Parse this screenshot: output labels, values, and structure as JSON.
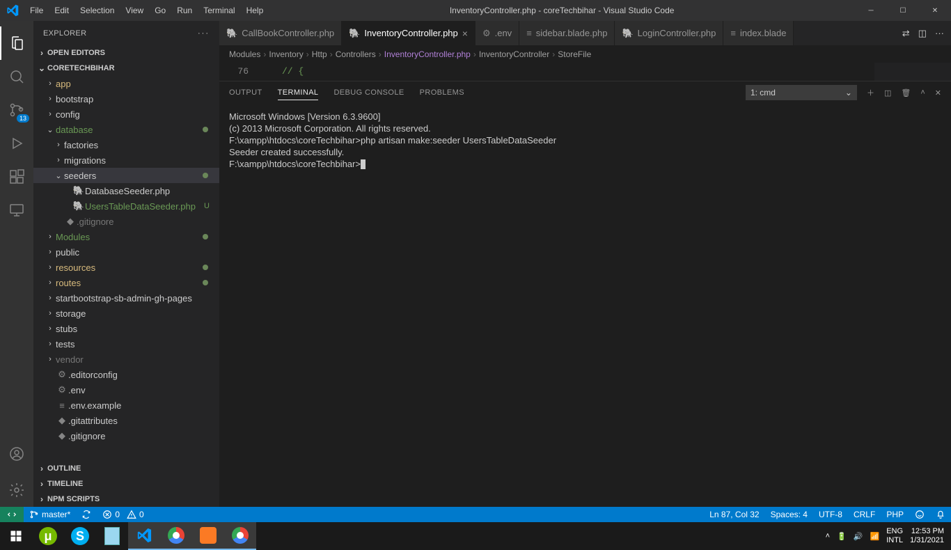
{
  "titlebar": {
    "menus": [
      "File",
      "Edit",
      "Selection",
      "View",
      "Go",
      "Run",
      "Terminal",
      "Help"
    ],
    "title": "InventoryController.php - coreTechbihar - Visual Studio Code"
  },
  "activitybar": {
    "badge": "13"
  },
  "sidebar": {
    "title": "EXPLORER",
    "sections": {
      "open_editors": "OPEN EDITORS",
      "project": "CORETECHBIHAR",
      "outline": "OUTLINE",
      "timeline": "TIMELINE",
      "npm": "NPM SCRIPTS"
    },
    "tree": [
      {
        "d": 1,
        "c": ">",
        "lbl": "app",
        "cls": "accent",
        "dot": false
      },
      {
        "d": 1,
        "c": ">",
        "lbl": "bootstrap",
        "dot": false
      },
      {
        "d": 1,
        "c": ">",
        "lbl": "config",
        "dot": false
      },
      {
        "d": 1,
        "c": "v",
        "lbl": "database",
        "cls": "green-f",
        "dot": true
      },
      {
        "d": 2,
        "c": ">",
        "lbl": "factories",
        "dot": false
      },
      {
        "d": 2,
        "c": ">",
        "lbl": "migrations",
        "dot": false
      },
      {
        "d": 2,
        "c": "v",
        "lbl": "seeders",
        "sel": true,
        "dot": true
      },
      {
        "d": 3,
        "c": "",
        "icon": "php",
        "lbl": "DatabaseSeeder.php",
        "dot": false
      },
      {
        "d": 3,
        "c": "",
        "icon": "php",
        "lbl": "UsersTableDataSeeder.php",
        "cls": "green-f",
        "status": "U",
        "dot": false
      },
      {
        "d": 2,
        "c": "",
        "icon": "dot",
        "lbl": ".gitignore",
        "muted": true,
        "dot": false
      },
      {
        "d": 1,
        "c": ">",
        "lbl": "Modules",
        "cls": "green-f",
        "dot": true
      },
      {
        "d": 1,
        "c": ">",
        "lbl": "public",
        "dot": false
      },
      {
        "d": 1,
        "c": ">",
        "lbl": "resources",
        "cls": "accent",
        "dot": true
      },
      {
        "d": 1,
        "c": ">",
        "lbl": "routes",
        "cls": "accent",
        "dot": true
      },
      {
        "d": 1,
        "c": ">",
        "lbl": "startbootstrap-sb-admin-gh-pages",
        "dot": false
      },
      {
        "d": 1,
        "c": ">",
        "lbl": "storage",
        "dot": false
      },
      {
        "d": 1,
        "c": ">",
        "lbl": "stubs",
        "dot": false
      },
      {
        "d": 1,
        "c": ">",
        "lbl": "tests",
        "dot": false
      },
      {
        "d": 1,
        "c": ">",
        "lbl": "vendor",
        "muted": true,
        "dot": false
      },
      {
        "d": 1,
        "c": "",
        "icon": "gear",
        "lbl": ".editorconfig",
        "dot": false
      },
      {
        "d": 1,
        "c": "",
        "icon": "gear",
        "lbl": ".env",
        "dot": false
      },
      {
        "d": 1,
        "c": "",
        "icon": "lines",
        "lbl": ".env.example",
        "dot": false
      },
      {
        "d": 1,
        "c": "",
        "icon": "dot",
        "lbl": ".gitattributes",
        "dot": false
      },
      {
        "d": 1,
        "c": "",
        "icon": "dot",
        "lbl": ".gitignore",
        "dot": false
      }
    ]
  },
  "tabs": [
    {
      "icon": "php",
      "label": "CallBookController.php"
    },
    {
      "icon": "php",
      "label": "InventoryController.php",
      "active": true,
      "close": true
    },
    {
      "icon": "gear",
      "label": ".env"
    },
    {
      "icon": "lines",
      "label": "sidebar.blade.php"
    },
    {
      "icon": "php",
      "label": "LoginController.php"
    },
    {
      "icon": "lines",
      "label": "index.blade"
    }
  ],
  "breadcrumb": [
    "Modules",
    "Inventory",
    "Http",
    "Controllers",
    "InventoryController.php",
    "InventoryController",
    "StoreFile"
  ],
  "code": {
    "line_no": "76",
    "text": "//  {"
  },
  "panel": {
    "tabs": [
      "OUTPUT",
      "TERMINAL",
      "DEBUG CONSOLE",
      "PROBLEMS"
    ],
    "active": "TERMINAL",
    "select": "1: cmd",
    "terminal_lines": [
      "Microsoft Windows [Version 6.3.9600]",
      "(c) 2013 Microsoft Corporation. All rights reserved.",
      "",
      "F:\\xampp\\htdocs\\coreTechbihar>php artisan make:seeder UsersTableDataSeeder",
      "Seeder created successfully.",
      "",
      "F:\\xampp\\htdocs\\coreTechbihar>"
    ]
  },
  "statusbar": {
    "branch": "master*",
    "sync": "",
    "errors": "0",
    "warnings": "0",
    "ln": "Ln 87, Col 32",
    "spaces": "Spaces: 4",
    "encoding": "UTF-8",
    "eol": "CRLF",
    "lang": "PHP",
    "feedback": ""
  },
  "taskbar": {
    "lang": "ENG",
    "lang2": "INTL",
    "time": "12:53 PM",
    "date": "1/31/2021"
  }
}
